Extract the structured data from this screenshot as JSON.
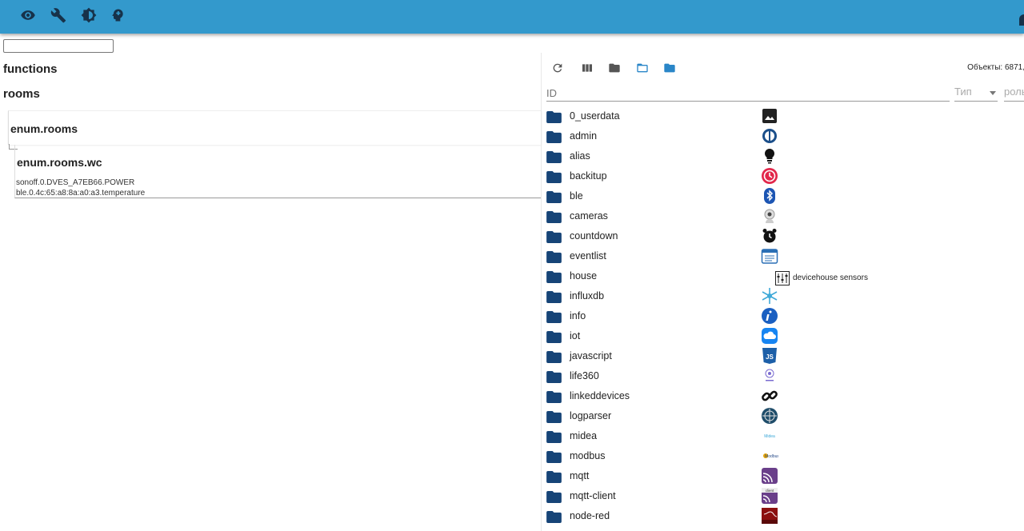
{
  "toolbar": {
    "icons": [
      "eye-icon",
      "wrench-icon",
      "brightness-icon",
      "head-icon"
    ]
  },
  "search": {
    "value": "",
    "placeholder": ""
  },
  "sections": {
    "functions": "functions",
    "rooms": "rooms"
  },
  "enum_rooms": {
    "title": "enum.rooms"
  },
  "enum_rooms_wc": {
    "title": "enum.rooms.wc",
    "members": [
      "sonoff.0.DVES_A7EB66.POWER",
      "ble.0.4c:65:a8:8a:a0:a3.temperature"
    ]
  },
  "objects": {
    "count_label": "Объекты: 6871,",
    "toolbar_icons": [
      "refresh-icon",
      "columns-icon",
      "folder-icon",
      "folder-open-icon",
      "folder-blue-icon"
    ],
    "filters": {
      "id_placeholder": "ID",
      "type_placeholder": "Тип",
      "role_placeholder": "роль"
    },
    "accent_color": "#164477",
    "rows": [
      {
        "name": "0_userdata",
        "icon": "image-icon"
      },
      {
        "name": "admin",
        "icon": "admin-icon"
      },
      {
        "name": "alias",
        "icon": "bulb-icon"
      },
      {
        "name": "backitup",
        "icon": "backitup-icon"
      },
      {
        "name": "ble",
        "icon": "bluetooth-icon"
      },
      {
        "name": "cameras",
        "icon": "camera-icon"
      },
      {
        "name": "countdown",
        "icon": "alarm-icon"
      },
      {
        "name": "eventlist",
        "icon": "calendar-icon"
      },
      {
        "name": "house",
        "icon": "none"
      },
      {
        "name": "influxdb",
        "icon": "influxdb-icon"
      },
      {
        "name": "info",
        "icon": "info-icon"
      },
      {
        "name": "iot",
        "icon": "cloud-icon"
      },
      {
        "name": "javascript",
        "icon": "js-icon"
      },
      {
        "name": "life360",
        "icon": "life360-icon"
      },
      {
        "name": "linkeddevices",
        "icon": "link-icon"
      },
      {
        "name": "logparser",
        "icon": "logparser-icon"
      },
      {
        "name": "midea",
        "icon": "midea-icon"
      },
      {
        "name": "modbus",
        "icon": "modbus-icon"
      },
      {
        "name": "mqtt",
        "icon": "mqtt-icon"
      },
      {
        "name": "mqtt-client",
        "icon": "mqtt-client-icon"
      },
      {
        "name": "node-red",
        "icon": "node-red-icon"
      }
    ],
    "house_device": {
      "label": "devicehouse sensors",
      "icon": "device-icon"
    }
  }
}
